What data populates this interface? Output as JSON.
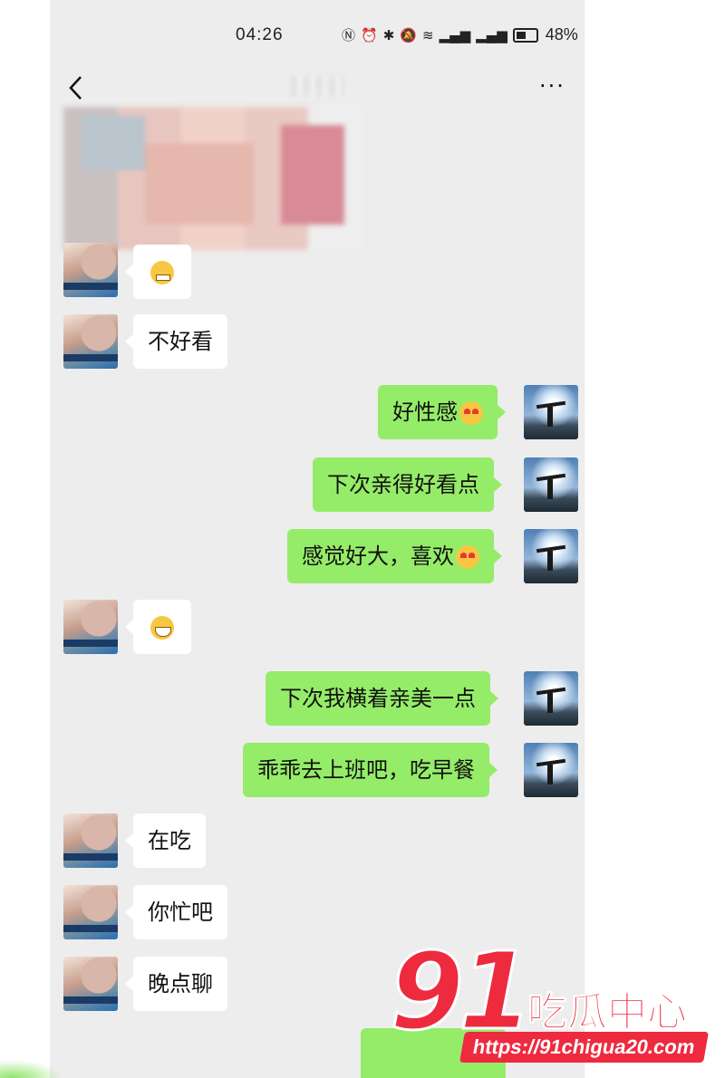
{
  "status_bar": {
    "time": "04:26",
    "icons": [
      "nfc-icon",
      "alarm-icon",
      "bluetooth-icon",
      "mute-icon",
      "wifi-icon",
      "signal-1-icon",
      "signal-2-icon",
      "battery-icon"
    ],
    "battery": "48%"
  },
  "nav": {
    "back_icon": "chevron-left-icon",
    "more_label": "···"
  },
  "messages": [
    {
      "side": "left",
      "text": ""
    },
    {
      "side": "left",
      "text": "不好看"
    },
    {
      "side": "right",
      "text": "好性感"
    },
    {
      "side": "right",
      "text": "下次亲得好看点"
    },
    {
      "side": "right",
      "text": "感觉好大，喜欢"
    },
    {
      "side": "left",
      "text": ""
    },
    {
      "side": "right",
      "text": "下次我横着亲美一点"
    },
    {
      "side": "right",
      "text": "乖乖去上班吧，吃早餐"
    },
    {
      "side": "left",
      "text": "在吃"
    },
    {
      "side": "left",
      "text": "你忙吧"
    },
    {
      "side": "left",
      "text": "晚点聊"
    }
  ],
  "watermark": {
    "number": "91",
    "title": "吃瓜中心",
    "url": "https://91chigua20.com"
  },
  "colors": {
    "chat_bg": "#ededed",
    "bubble_self": "#95ec69",
    "bubble_other": "#ffffff",
    "brand_red": "#ee2a3f"
  }
}
